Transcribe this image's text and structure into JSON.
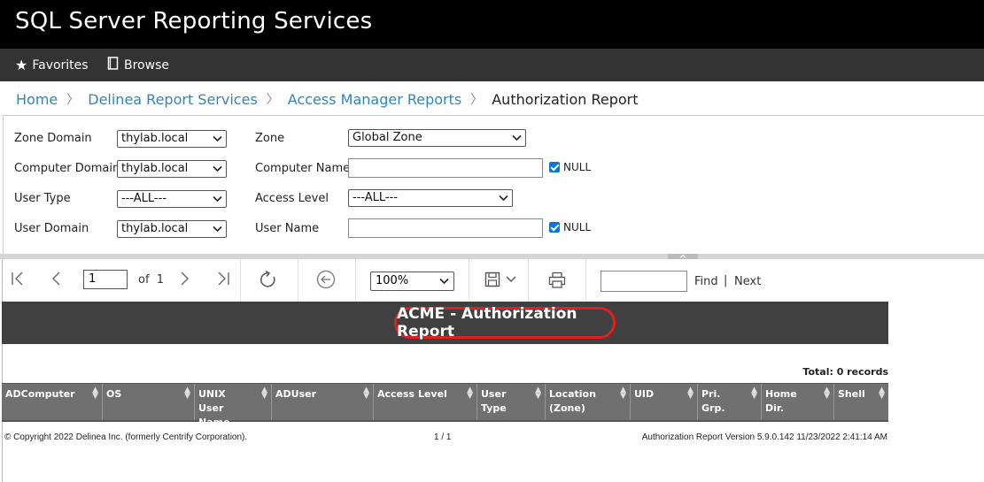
{
  "app": {
    "title": "SQL Server Reporting Services"
  },
  "nav": {
    "favorites": "Favorites",
    "browse": "Browse"
  },
  "breadcrumb": {
    "home": "Home",
    "level1": "Delinea Report Services",
    "level2": "Access Manager Reports",
    "current": "Authorization Report"
  },
  "params": {
    "zone_domain": {
      "label": "Zone Domain",
      "value": "thylab.local"
    },
    "computer_domain": {
      "label": "Computer Domain",
      "value": "thylab.local"
    },
    "user_type": {
      "label": "User Type",
      "value": "---ALL---"
    },
    "user_domain": {
      "label": "User Domain",
      "value": "thylab.local"
    },
    "zone": {
      "label": "Zone",
      "value": "Global Zone"
    },
    "computer_name": {
      "label": "Computer Name",
      "value": "",
      "null_label": "NULL",
      "null_checked": true
    },
    "access_level": {
      "label": "Access Level",
      "value": "---ALL---"
    },
    "user_name": {
      "label": "User Name",
      "value": "",
      "null_label": "NULL",
      "null_checked": true
    }
  },
  "toolbar": {
    "page": "1",
    "of_label": "of",
    "total_pages": "1",
    "zoom": "100%",
    "find_label": "Find",
    "find_sep": "|",
    "next_label": "Next"
  },
  "report": {
    "title": "ACME - Authorization Report",
    "total": "Total: 0 records",
    "columns": [
      "ADComputer",
      "OS",
      "UNIX User Name",
      "ADUser",
      "Access Level",
      "User Type",
      "Location (Zone)",
      "UID",
      "Pri. Grp.",
      "Home Dir.",
      "Shell"
    ],
    "footer_left": "© Copyright 2022 Delinea Inc. (formerly Centrify Corporation).",
    "footer_center": "1 / 1",
    "footer_right": "Authorization Report Version 5.9.0.142 11/23/2022 2:41:14 AM"
  },
  "colors": {
    "accent": "#2e86b8",
    "header_bg": "#000000",
    "nav_bg": "#333333",
    "report_header": "#404040",
    "highlight": "#e02020"
  },
  "icons": [
    "star-icon",
    "book-icon",
    "first-page-icon",
    "prev-page-icon",
    "next-page-icon",
    "last-page-icon",
    "refresh-icon",
    "back-icon",
    "save-icon",
    "print-icon",
    "checkbox-icon",
    "sort-icon"
  ]
}
